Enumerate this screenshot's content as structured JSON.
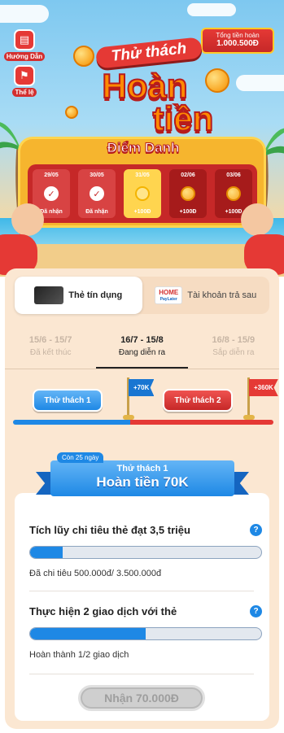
{
  "side_buttons": [
    {
      "label": "Hướng Dẫn",
      "icon": "book-icon"
    },
    {
      "label": "Thể lệ",
      "icon": "flag-icon"
    }
  ],
  "total_refund": {
    "label": "Tổng tiền hoàn",
    "value": "1.000.500Đ"
  },
  "hero": {
    "title_small": "Thử thách",
    "title_big_1": "Hoàn",
    "title_big_2": "tiền"
  },
  "checkin": {
    "title": "Điểm Danh",
    "days": [
      {
        "date": "29/05",
        "status": "Đã nhận",
        "state": "done"
      },
      {
        "date": "30/05",
        "status": "Đã nhận",
        "state": "done"
      },
      {
        "date": "31/05",
        "status": "+100Đ",
        "state": "today"
      },
      {
        "date": "02/06",
        "status": "+100Đ",
        "state": "future"
      },
      {
        "date": "03/06",
        "status": "+100Đ",
        "state": "future"
      }
    ]
  },
  "product_tabs": [
    {
      "label": "Thẻ tín dụng",
      "active": true
    },
    {
      "label": "Tài khoản trả sau",
      "active": false,
      "logo_main": "HOME",
      "logo_sub": "PayLater"
    }
  ],
  "periods": [
    {
      "range": "15/6 - 15/7",
      "status": "Đã kết thúc",
      "state": "past"
    },
    {
      "range": "16/7 - 15/8",
      "status": "Đang diễn ra",
      "state": "current"
    },
    {
      "range": "16/8 - 15/9",
      "status": "Sắp diễn ra",
      "state": "next"
    }
  ],
  "challenges": [
    {
      "label": "Thử thách 1",
      "reward": "+70K"
    },
    {
      "label": "Thử thách 2",
      "reward": "+360K"
    }
  ],
  "current_challenge": {
    "days_left": "Còn 25 ngày",
    "subtitle": "Thử thách 1",
    "title": "Hoàn tiền 70K"
  },
  "tasks": [
    {
      "title": "Tích lũy chi tiêu thẻ đạt 3,5 triệu",
      "progress_fraction": 0.14,
      "detail": "Đã chi tiêu 500.000đ/ 3.500.000đ"
    },
    {
      "title": "Thực hiện 2 giao dịch với thẻ",
      "progress_fraction": 0.5,
      "detail": "Hoàn thành 1/2 giao dịch"
    }
  ],
  "claim_button": "Nhận 70.000Đ",
  "colors": {
    "accent_blue": "#1e88e5",
    "accent_red": "#e53935",
    "gold": "#f6b52e",
    "panel": "#fbe7d2"
  }
}
